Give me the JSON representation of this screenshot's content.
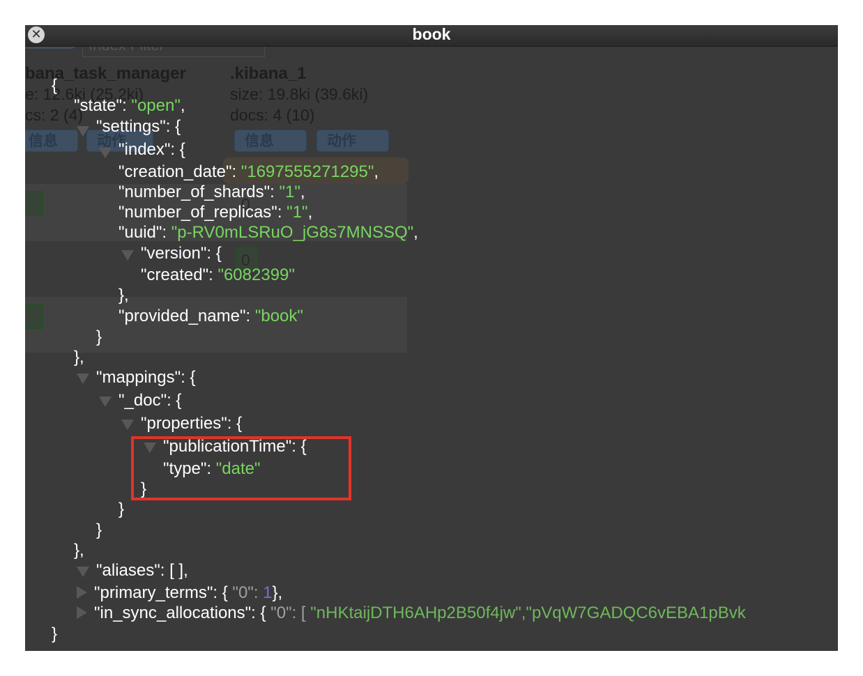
{
  "window": {
    "title": "book",
    "close_glyph": "✕"
  },
  "background": {
    "index_filter_placeholder": "Index Filter",
    "indices": [
      {
        "name": "bana_task_manager",
        "size": "e: 12.6ki (25.2ki)",
        "docs": "cs: 2 (4)",
        "info_label": "信息",
        "action_label": "动作"
      },
      {
        "name": ".kibana_1",
        "size": "size: 19.8ki (39.6ki)",
        "docs": "docs: 4 (10)",
        "info_label": "信息",
        "action_label": "动作"
      }
    ],
    "shard_label": "0"
  },
  "json_lines": [
    {
      "open": "{"
    },
    {
      "key": "\"state\"",
      "value": "\"open\"",
      "tail": ","
    },
    {
      "key": "\"settings\"",
      "tail": ": {"
    },
    {
      "key": "\"index\"",
      "tail": ": {"
    },
    {
      "key": "\"creation_date\"",
      "value": "\"1697555271295\"",
      "tail": ","
    },
    {
      "key": "\"number_of_shards\"",
      "value": "\"1\"",
      "tail": ","
    },
    {
      "key": "\"number_of_replicas\"",
      "value": "\"1\"",
      "tail": ","
    },
    {
      "key": "\"uuid\"",
      "value": "\"p-RV0mLSRuO_jG8s7MNSSQ\"",
      "tail": ","
    },
    {
      "key": "\"version\"",
      "tail": ": {"
    },
    {
      "key": "\"created\"",
      "value": "\"6082399\""
    },
    {
      "close": "},"
    },
    {
      "key": "\"provided_name\"",
      "value": "\"book\""
    },
    {
      "close": "}"
    },
    {
      "close": "},"
    },
    {
      "key": "\"mappings\"",
      "tail": ": {"
    },
    {
      "key": "\"_doc\"",
      "tail": ": {"
    },
    {
      "key": "\"properties\"",
      "tail": ": {"
    },
    {
      "key": "\"publicationTime\"",
      "tail": ": {"
    },
    {
      "key": "\"type\"",
      "value": "\"date\""
    },
    {
      "close": "}"
    },
    {
      "close": "}"
    },
    {
      "close": "}"
    },
    {
      "close": "},"
    },
    {
      "key": "\"aliases\"",
      "tail": ": [ ],"
    },
    {
      "key": "\"primary_terms\"",
      "mid": ": { ",
      "key2": "\"0\"",
      "colon2": ": ",
      "num": "1",
      "tail": "},"
    },
    {
      "key": "\"in_sync_allocations\"",
      "mid": ": { ",
      "key2": "\"0\"",
      "colon2": ": [ ",
      "value": "\"nHKtaijDTH6AHp2B50f4jw\",\"pVqW7GADQC6vEBA1pBvk"
    },
    {
      "close": "}"
    }
  ],
  "colors": {
    "string": "#78d661",
    "number": "#6f6fdc",
    "highlight_box": "#e3332a"
  }
}
